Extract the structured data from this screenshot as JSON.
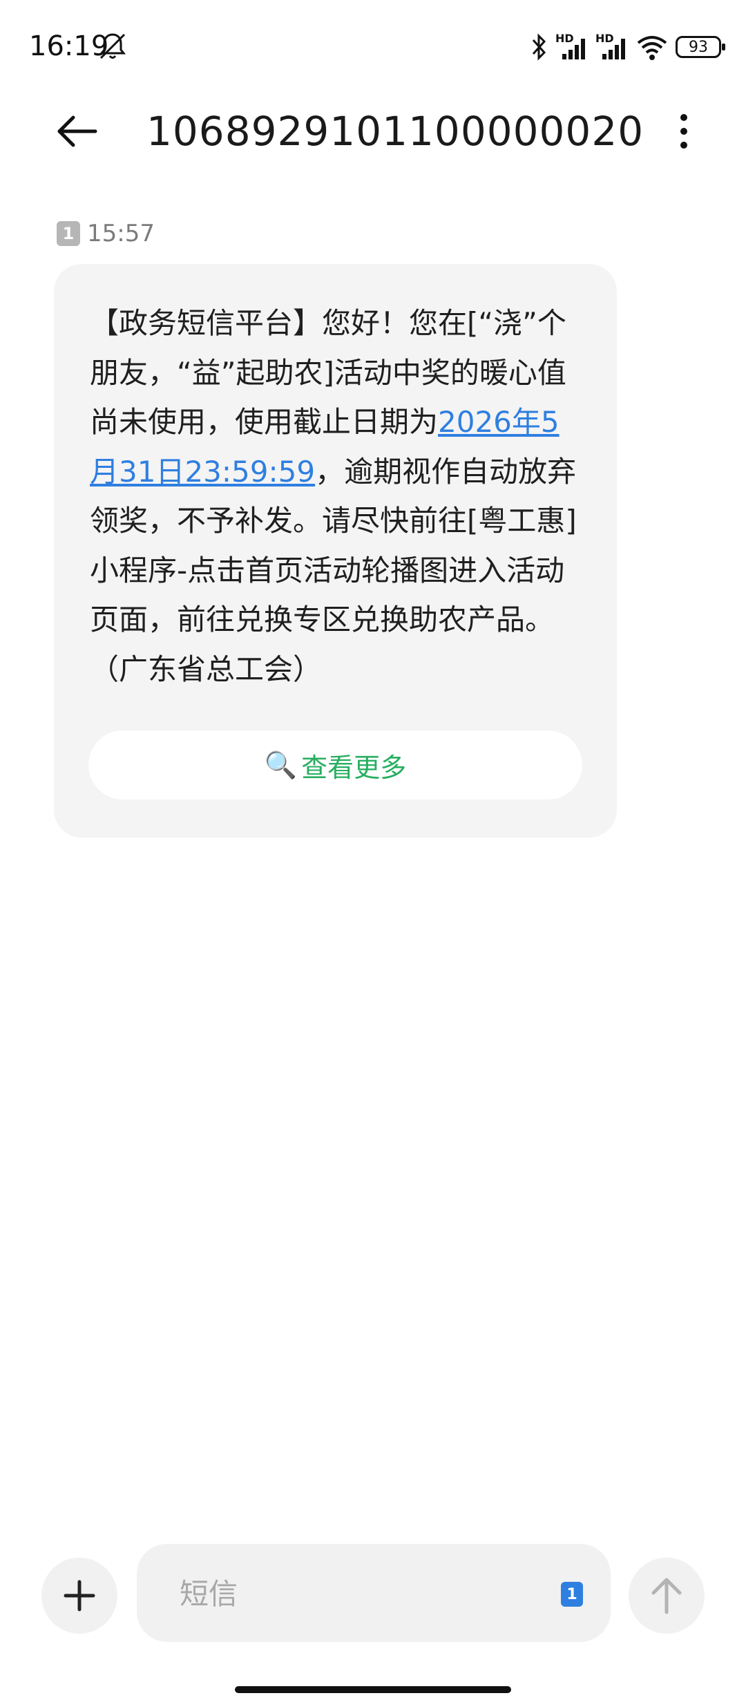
{
  "status_bar": {
    "time": "16:19",
    "battery": "93",
    "hd_label": "HD"
  },
  "header": {
    "title": "1068929101100000020"
  },
  "message": {
    "sim_badge": "1",
    "time": "15:57",
    "text_before": "【政务短信平台】您好！您在[“浇”个朋友，“益”起助农]活动中奖的暖心值尚未使用，使用截止日期为",
    "link_text": "2026年5月31日23:59:59",
    "text_after": "，逾期视作自动放弃领奖，不予补发。请尽快前往[粤工惠]小程序-点击首页活动轮播图进入活动页面，前往兑换专区兑换助农产品。（广东省总工会）",
    "view_more_icon": "🔍",
    "view_more_label": "查看更多"
  },
  "composer": {
    "placeholder": "短信",
    "sim": "1"
  },
  "colors": {
    "link": "#2f7fe0",
    "view_more": "#27ae60",
    "bubble": "#f4f4f4",
    "sim_badge": "#2f7fe0"
  },
  "icons": [
    "mute-bell-icon",
    "bluetooth-icon",
    "signal-icon",
    "wifi-icon",
    "battery-icon",
    "back-arrow-icon",
    "more-vert-icon",
    "search-icon",
    "plus-icon",
    "send-arrow-icon"
  ]
}
